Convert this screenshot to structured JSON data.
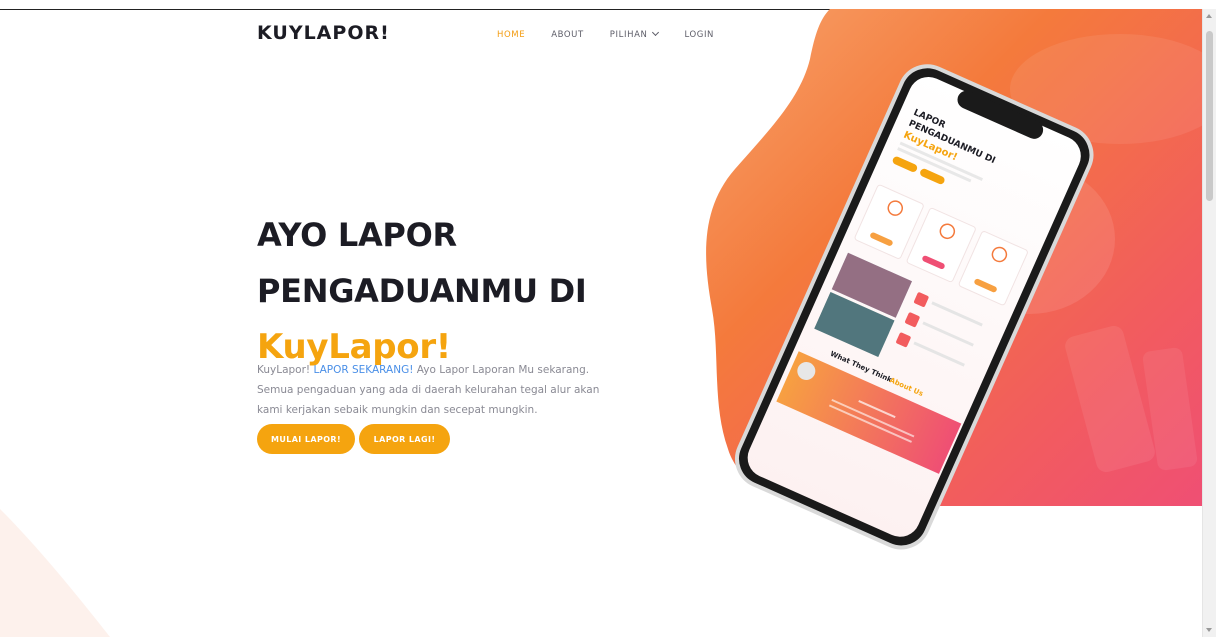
{
  "brand": "KUYLAPOR!",
  "nav": {
    "home": "HOME",
    "about": "ABOUT",
    "pilihan": "PILIHAN",
    "login": "LOGIN"
  },
  "hero": {
    "line1": "AYO LAPOR",
    "line2": "PENGADUANMU DI",
    "accent": "KuyLapor!",
    "desc_prefix": "KuyLapor!",
    "desc_link": "LAPOR SEKARANG!",
    "desc_rest": "Ayo Lapor Laporan Mu sekarang. Semua pengaduan yang ada di daerah kelurahan tegal alur akan kami kerjakan sebaik mungkin dan secepat mungkin.",
    "btn_primary": "MULAI LAPOR!",
    "btn_secondary": "LAPOR LAGI!"
  },
  "phone": {
    "title_line1": "LAPOR",
    "title_line2": "PENGADUANMU DI",
    "title_accent": "KuyLapor!",
    "testimonial_title": "What They Think",
    "testimonial_accent": "About Us"
  },
  "colors": {
    "accent": "#f5a40f",
    "link": "#4a8fe7",
    "text_dark": "#1c1c24",
    "blob_orange": "#f47a3c",
    "blob_pink": "#f0567a"
  }
}
